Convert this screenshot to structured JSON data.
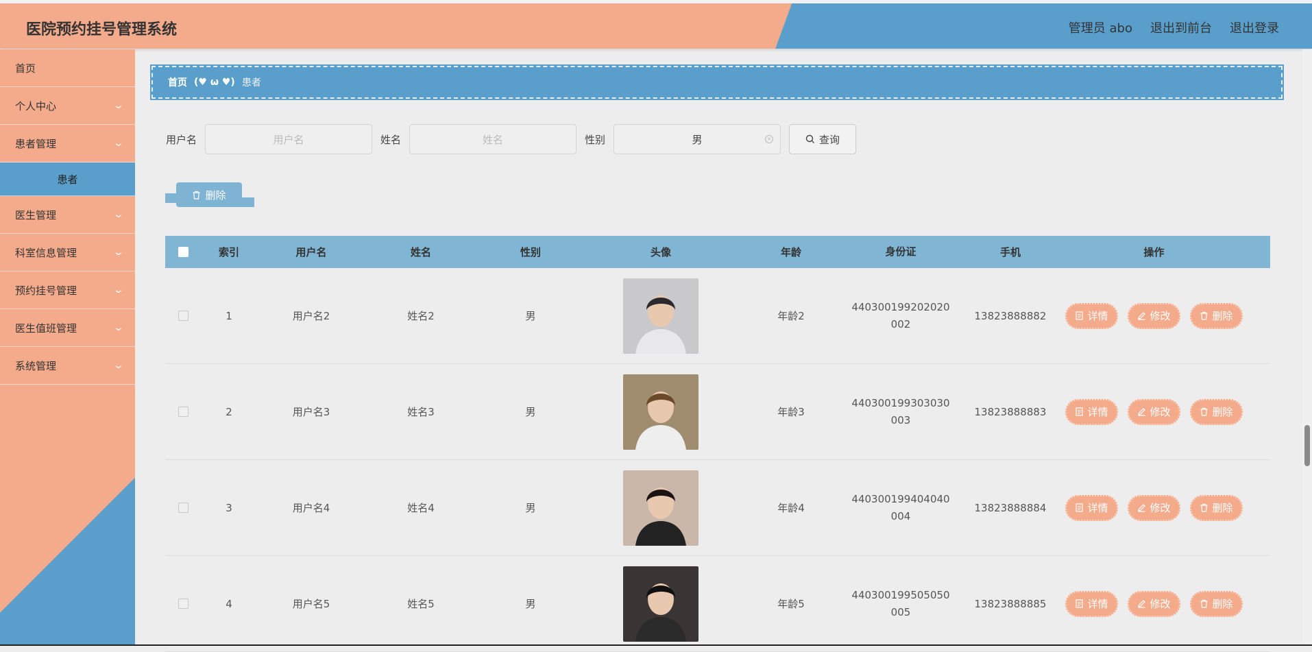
{
  "header": {
    "title": "医院预约挂号管理系统",
    "user": "管理员 abo",
    "back_to_front": "退出到前台",
    "logout": "退出登录"
  },
  "sidebar": {
    "items": [
      {
        "label": "首页"
      },
      {
        "label": "个人中心"
      },
      {
        "label": "患者管理"
      },
      {
        "label": "患者"
      },
      {
        "label": "医生管理"
      },
      {
        "label": "科室信息管理"
      },
      {
        "label": "预约挂号管理"
      },
      {
        "label": "医生值班管理"
      },
      {
        "label": "系统管理"
      }
    ]
  },
  "breadcrumb": {
    "home": "首页",
    "decoration": "(♥ ω ♥)",
    "current": "患者"
  },
  "search": {
    "username_label": "用户名",
    "username_placeholder": "用户名",
    "name_label": "姓名",
    "name_placeholder": "姓名",
    "gender_label": "性别",
    "gender_value": "男",
    "query_button": "查询"
  },
  "actions": {
    "delete_button": "删除"
  },
  "table": {
    "headers": [
      "索引",
      "用户名",
      "姓名",
      "性别",
      "头像",
      "年龄",
      "身份证",
      "手机",
      "操作"
    ],
    "op_labels": {
      "detail": "详情",
      "edit": "修改",
      "delete": "删除"
    },
    "rows": [
      {
        "index": "1",
        "username": "用户名2",
        "name": "姓名2",
        "gender": "男",
        "age": "年龄2",
        "id_line1": "440300199202020",
        "id_line2": "002",
        "phone": "13823888882",
        "avatar_bg": "#c9c9cc",
        "avatar_hair": "#2a2a2e",
        "avatar_shirt": "#e8e8ea"
      },
      {
        "index": "2",
        "username": "用户名3",
        "name": "姓名3",
        "gender": "男",
        "age": "年龄3",
        "id_line1": "440300199303030",
        "id_line2": "003",
        "phone": "13823888883",
        "avatar_bg": "#a08c6e",
        "avatar_hair": "#6b4a2a",
        "avatar_shirt": "#eeeeee"
      },
      {
        "index": "3",
        "username": "用户名4",
        "name": "姓名4",
        "gender": "男",
        "age": "年龄4",
        "id_line1": "440300199404040",
        "id_line2": "004",
        "phone": "13823888884",
        "avatar_bg": "#c9b8aa",
        "avatar_hair": "#1c1414",
        "avatar_shirt": "#222222"
      },
      {
        "index": "4",
        "username": "用户名5",
        "name": "姓名5",
        "gender": "男",
        "age": "年龄5",
        "id_line1": "440300199505050",
        "id_line2": "005",
        "phone": "13823888885",
        "avatar_bg": "#3a3434",
        "avatar_hair": "#101010",
        "avatar_shirt": "#2a2a2a"
      }
    ]
  },
  "colors": {
    "salmon": "#f4ab8c",
    "blue": "#5a9fcb",
    "table_header": "#81b5d4"
  }
}
